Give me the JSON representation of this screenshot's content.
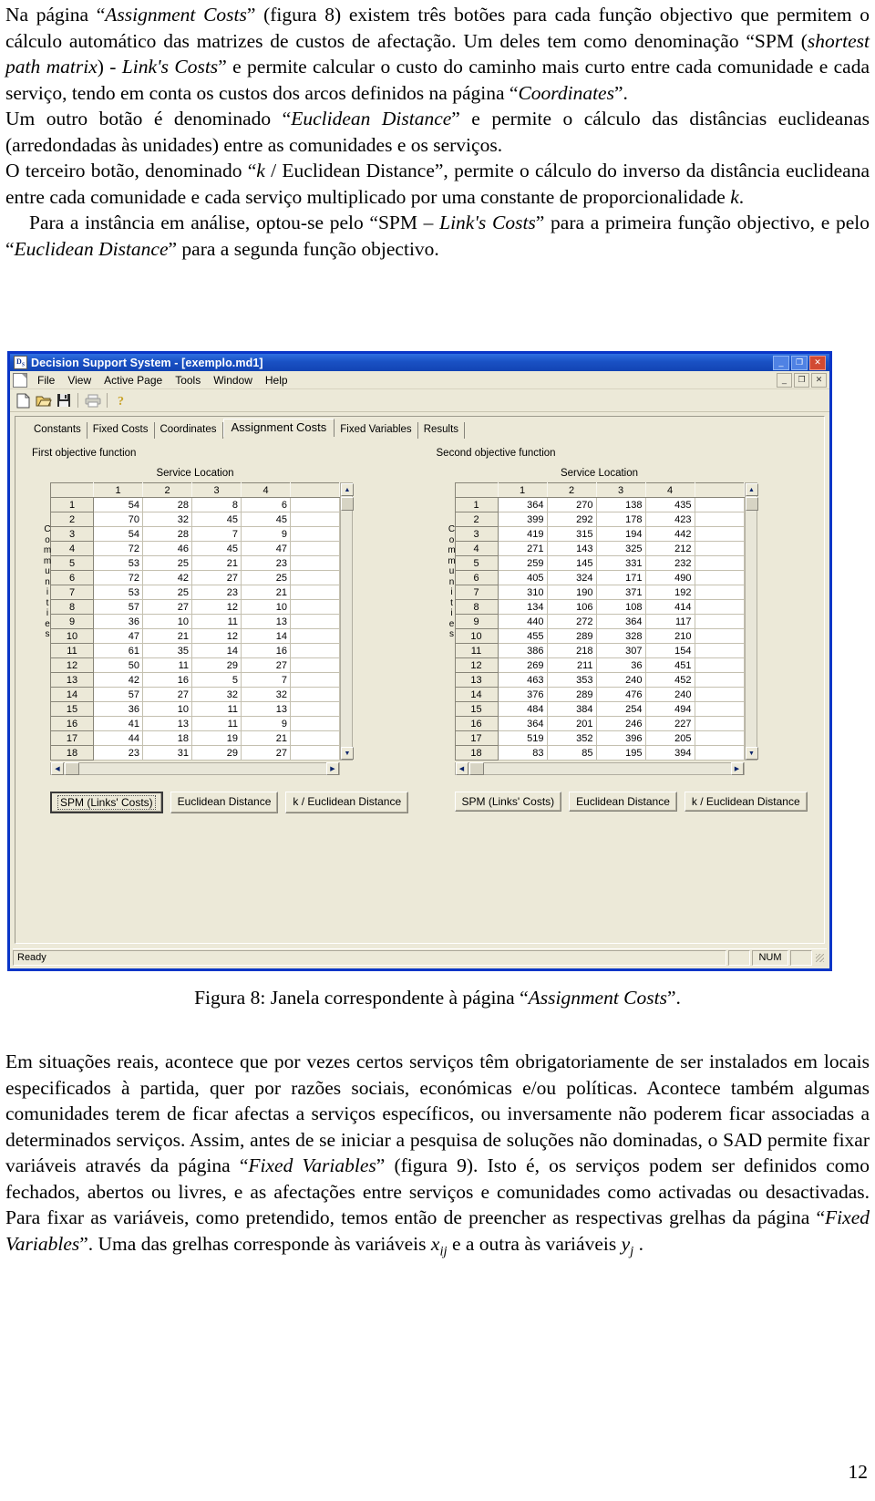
{
  "document": {
    "page_number": "12",
    "paragraph_top": [
      "Na página “Assignment Costs” (figura 8) existem três botões para cada função objectivo que permitem o cálculo automático das matrizes de custos de afectação. Um deles tem como denominação “SPM (shortest path matrix) - Link's Costs” e permite calcular o custo do caminho mais curto entre cada comunidade e cada serviço, tendo em conta os custos dos arcos definidos na página “Coordinates”.",
      "Um outro botão é denominado “Euclidean Distance” e permite o cálculo das distâncias euclideanas (arredondadas às unidades) entre as comunidades e os serviços.",
      "O terceiro botão, denominado “k / Euclidean Distance”, permite o cálculo do inverso da distância euclideana entre cada comunidade e cada serviço multiplicado por uma constante de proporcionalidade k.",
      "Para a instância em análise, optou-se pelo “SPM – Link's Costs” para a primeira função objectivo, e pelo “Euclidean Distance” para a segunda função objectivo."
    ],
    "caption": "Figura 8: Janela correspondente à página “Assignment Costs”.",
    "paragraph_bottom": [
      "Em situações reais, acontece que por vezes certos serviços têm obrigatoriamente de ser instalados em locais especificados à partida, quer por razões sociais, económicas e/ou políticas. Acontece também algumas comunidades terem de ficar afectas a serviços específicos, ou inversamente não poderem ficar associadas a determinados serviços. Assim, antes de se iniciar a pesquisa de soluções não dominadas, o SAD permite fixar variáveis através da página “Fixed Variables” (figura 9). Isto é, os serviços podem ser definidos como fechados, abertos ou livres, e as afectações entre serviços e comunidades como activadas ou desactivadas. Para fixar as variáveis, como pretendido, temos então de preencher as respectivas grelhas da página “Fixed Variables”. Uma das grelhas corresponde às variáveis xij e a outra às variáveis yj."
    ]
  },
  "app": {
    "title": "Decision Support System - [exemplo.md1]",
    "title_icon": "document-icon",
    "window_buttons": [
      {
        "name": "minimize",
        "glyph": "_"
      },
      {
        "name": "maximize",
        "glyph": "❐"
      },
      {
        "name": "close",
        "glyph": "✕"
      }
    ],
    "mdi_buttons": [
      {
        "name": "mdi-minimize",
        "glyph": "_"
      },
      {
        "name": "mdi-restore",
        "glyph": "❐"
      },
      {
        "name": "mdi-close",
        "glyph": "✕"
      }
    ],
    "menu": [
      "File",
      "View",
      "Active Page",
      "Tools",
      "Window",
      "Help"
    ],
    "toolbar": [
      "new-icon",
      "open-icon",
      "save-icon",
      "print-icon",
      "help-icon"
    ],
    "tabs": [
      {
        "label": "Constants",
        "active": false
      },
      {
        "label": "Fixed Costs",
        "active": false
      },
      {
        "label": "Coordinates",
        "active": false
      },
      {
        "label": "Assignment Costs",
        "active": true
      },
      {
        "label": "Fixed Variables",
        "active": false
      },
      {
        "label": "Results",
        "active": false
      }
    ],
    "status": {
      "text": "Ready",
      "num": "NUM"
    },
    "buttons": [
      "SPM (Links' Costs)",
      "Euclidean Distance",
      "k / Euclidean Distance"
    ],
    "panes": [
      {
        "heading": "First objective function",
        "column_axis_label": "Service Location",
        "row_axis_label": "Communities",
        "columns": [
          "1",
          "2",
          "3",
          "4"
        ],
        "rows": [
          "1",
          "2",
          "3",
          "4",
          "5",
          "6",
          "7",
          "8",
          "9",
          "10",
          "11",
          "12",
          "13",
          "14",
          "15",
          "16",
          "17",
          "18"
        ],
        "values": [
          [
            54,
            28,
            8,
            6
          ],
          [
            70,
            32,
            45,
            45
          ],
          [
            54,
            28,
            7,
            9
          ],
          [
            72,
            46,
            45,
            47
          ],
          [
            53,
            25,
            21,
            23
          ],
          [
            72,
            42,
            27,
            25
          ],
          [
            53,
            25,
            23,
            21
          ],
          [
            57,
            27,
            12,
            10
          ],
          [
            36,
            10,
            11,
            13
          ],
          [
            47,
            21,
            12,
            14
          ],
          [
            61,
            35,
            14,
            16
          ],
          [
            50,
            11,
            29,
            27
          ],
          [
            42,
            16,
            5,
            7
          ],
          [
            57,
            27,
            32,
            32
          ],
          [
            36,
            10,
            11,
            13
          ],
          [
            41,
            13,
            11,
            9
          ],
          [
            44,
            18,
            19,
            21
          ],
          [
            23,
            31,
            29,
            27
          ]
        ]
      },
      {
        "heading": "Second objective function",
        "column_axis_label": "Service Location",
        "row_axis_label": "Communities",
        "columns": [
          "1",
          "2",
          "3",
          "4"
        ],
        "rows": [
          "1",
          "2",
          "3",
          "4",
          "5",
          "6",
          "7",
          "8",
          "9",
          "10",
          "11",
          "12",
          "13",
          "14",
          "15",
          "16",
          "17",
          "18"
        ],
        "values": [
          [
            364,
            270,
            138,
            435
          ],
          [
            399,
            292,
            178,
            423
          ],
          [
            419,
            315,
            194,
            442
          ],
          [
            271,
            143,
            325,
            212
          ],
          [
            259,
            145,
            331,
            232
          ],
          [
            405,
            324,
            171,
            490
          ],
          [
            310,
            190,
            371,
            192
          ],
          [
            134,
            106,
            108,
            414
          ],
          [
            440,
            272,
            364,
            117
          ],
          [
            455,
            289,
            328,
            210
          ],
          [
            386,
            218,
            307,
            154
          ],
          [
            269,
            211,
            36,
            451
          ],
          [
            463,
            353,
            240,
            452
          ],
          [
            376,
            289,
            476,
            240
          ],
          [
            484,
            384,
            254,
            494
          ],
          [
            364,
            201,
            246,
            227
          ],
          [
            519,
            352,
            396,
            205
          ],
          [
            83,
            85,
            195,
            394
          ]
        ]
      }
    ]
  },
  "colors": {
    "title_bar": "#1a51c4",
    "window_border": "#0a36c8",
    "face": "#ece9d8",
    "grid_line": "#c4c0b0"
  }
}
